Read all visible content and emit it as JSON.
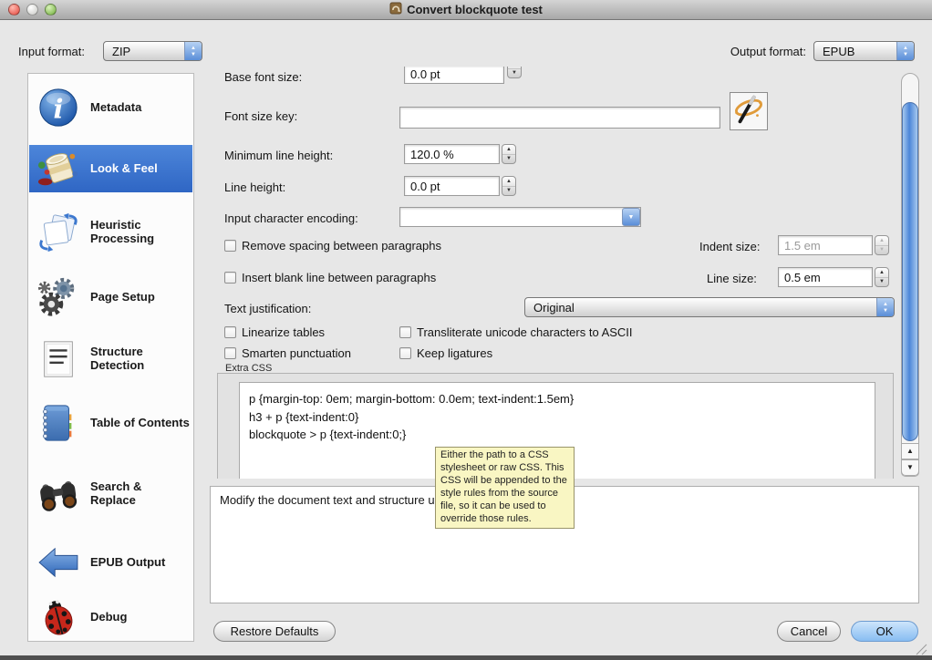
{
  "window": {
    "title": "Convert blockquote test"
  },
  "format_bar": {
    "input_label": "Input format:",
    "input_value": "ZIP",
    "output_label": "Output format:",
    "output_value": "EPUB"
  },
  "sidebar": {
    "items": [
      {
        "label": "Metadata",
        "icon": "info-icon",
        "selected": false
      },
      {
        "label": "Look & Feel",
        "icon": "paint-can-icon",
        "selected": true
      },
      {
        "label": "Heuristic Processing",
        "icon": "pages-icon",
        "selected": false
      },
      {
        "label": "Page Setup",
        "icon": "gears-icon",
        "selected": false
      },
      {
        "label": "Structure Detection",
        "icon": "document-icon",
        "selected": false
      },
      {
        "label": "Table of Contents",
        "icon": "notebook-icon",
        "selected": false
      },
      {
        "label": "Search & Replace",
        "icon": "binoculars-icon",
        "selected": false
      },
      {
        "label": "EPUB Output",
        "icon": "left-arrow-icon",
        "selected": false
      },
      {
        "label": "Debug",
        "icon": "ladybug-icon",
        "selected": false
      }
    ]
  },
  "panel": {
    "base_font_size": {
      "label": "Base font size:",
      "value": "0.0 pt"
    },
    "font_size_key": {
      "label": "Font size key:",
      "value": ""
    },
    "minimum_line_height": {
      "label": "Minimum line height:",
      "value": "120.0 %"
    },
    "line_height": {
      "label": "Line height:",
      "value": "0.0 pt"
    },
    "input_character_encoding": {
      "label": "Input character encoding:",
      "value": ""
    },
    "remove_spacing": {
      "label": "Remove spacing between paragraphs",
      "checked": false
    },
    "indent_size": {
      "label": "Indent size:",
      "value": "1.5 em",
      "disabled": true
    },
    "insert_blank_line": {
      "label": "Insert blank line between paragraphs",
      "checked": false
    },
    "line_size": {
      "label": "Line size:",
      "value": "0.5 em",
      "disabled": false
    },
    "text_justification": {
      "label": "Text justification:",
      "value": "Original"
    },
    "checkboxes": {
      "linearize_tables": "Linearize tables",
      "transliterate": "Transliterate unicode characters to ASCII",
      "smarten_punctuation": "Smarten punctuation",
      "keep_ligatures": "Keep ligatures"
    },
    "extra_css": {
      "label": "Extra CSS",
      "lines": [
        "p {margin-top: 0em; margin-bottom: 0.0em; text-indent:1.5em}",
        "h3 + p {text-indent:0}",
        "blockquote > p {text-indent:0;}"
      ]
    }
  },
  "tooltip": {
    "text": "Either the path to a CSS stylesheet or raw CSS. This CSS will be appended to the style rules from the source file, so it can be used to override those rules."
  },
  "help_box": {
    "text": "Modify the document text and structure using common patterns."
  },
  "footer": {
    "restore_defaults": "Restore Defaults",
    "cancel": "Cancel",
    "ok": "OK"
  },
  "colors": {
    "selection_blue": "#3b74d0",
    "tooltip_bg": "#f9f6c3",
    "ok_button_bg": "#88bdf2",
    "scrollbar_blue": "#4c86d8"
  }
}
